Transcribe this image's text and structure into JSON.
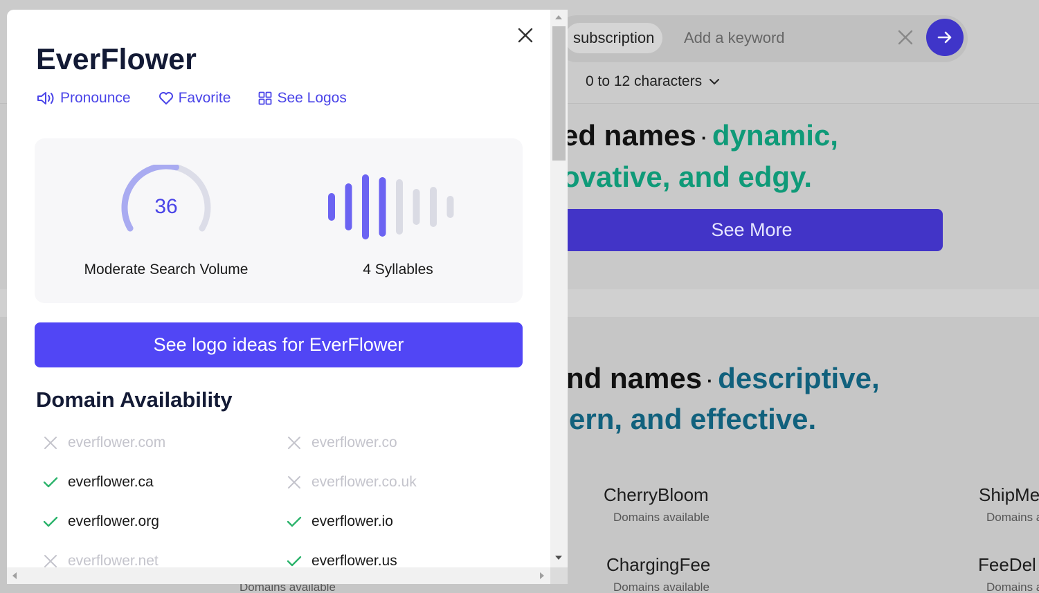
{
  "background": {
    "search": {
      "chip": "subscription",
      "placeholder": "Add a keyword"
    },
    "length_filter": "0 to 12 characters",
    "section1": {
      "line1_dark": "ed names",
      "line1_accent": "dynamic,",
      "line2_accent": "ovative, and edgy.",
      "see_more": "See More"
    },
    "section2": {
      "line1_dark": "nd names",
      "line1_accent": "descriptive,",
      "line2_accent": "ern, and effective."
    },
    "cards": [
      {
        "name": "CherryBloom",
        "sub": "Domains available"
      },
      {
        "name": "ShipMe",
        "sub": "Domains a"
      },
      {
        "name": "ChargingFee",
        "sub": "Domains available"
      },
      {
        "name": "FeeDel",
        "sub": "Domains a"
      },
      {
        "name": "",
        "sub": "Domains available"
      }
    ],
    "colors": {
      "accent": "#3f35c9",
      "teal": "#0f9a78",
      "blue": "#11617d"
    }
  },
  "modal": {
    "title": "EverFlower",
    "actions": [
      {
        "label": "Pronounce",
        "icon": "speaker-icon"
      },
      {
        "label": "Favorite",
        "icon": "heart-icon"
      },
      {
        "label": "See Logos",
        "icon": "grid-icon"
      }
    ],
    "search_volume": {
      "value": "36",
      "label": "Moderate Search Volume",
      "fraction": 0.36
    },
    "syllables": {
      "label": "4 Syllables",
      "count": 4
    },
    "logo_button": "See logo ideas for EverFlower",
    "domain_title": "Domain Availability",
    "domains": [
      {
        "name": "everflower.com",
        "available": false
      },
      {
        "name": "everflower.co",
        "available": false
      },
      {
        "name": "everflower.ca",
        "available": true
      },
      {
        "name": "everflower.co.uk",
        "available": false
      },
      {
        "name": "everflower.org",
        "available": true
      },
      {
        "name": "everflower.io",
        "available": true
      },
      {
        "name": "everflower.net",
        "available": false
      },
      {
        "name": "everflower.us",
        "available": true
      }
    ],
    "colors": {
      "primary": "#5146f5",
      "available": "#2bb36b",
      "taken": "#c4c4cc"
    }
  }
}
